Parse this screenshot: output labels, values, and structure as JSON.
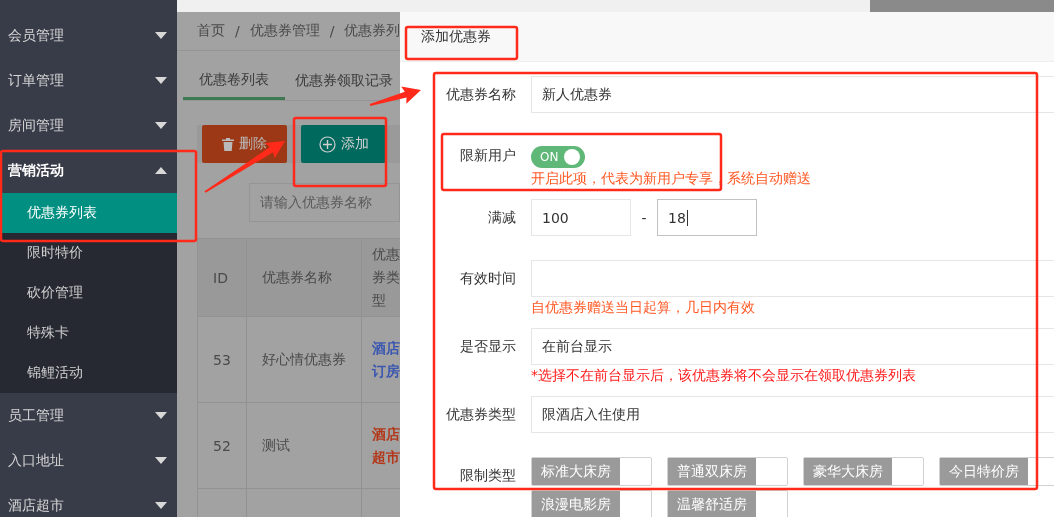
{
  "sidebar": {
    "items": [
      {
        "label": "会员管理",
        "expanded": false
      },
      {
        "label": "订单管理",
        "expanded": false
      },
      {
        "label": "房间管理",
        "expanded": false
      },
      {
        "label": "营销活动",
        "expanded": true,
        "children": [
          {
            "label": "优惠券列表",
            "selected": true
          },
          {
            "label": "限时特价",
            "selected": false
          },
          {
            "label": "砍价管理",
            "selected": false
          },
          {
            "label": "特殊卡",
            "selected": false
          },
          {
            "label": "锦鲤活动",
            "selected": false
          }
        ]
      },
      {
        "label": "员工管理",
        "expanded": false
      },
      {
        "label": "入口地址",
        "expanded": false
      },
      {
        "label": "酒店超市",
        "expanded": false
      }
    ]
  },
  "breadcrumb": {
    "items": [
      "首页",
      "优惠券管理",
      "优惠券列"
    ],
    "separator": "/"
  },
  "tabs": [
    {
      "label": "优惠卷列表",
      "selected": true
    },
    {
      "label": "优惠券领取记录",
      "selected": false
    }
  ],
  "toolbar": [
    {
      "label": "删除",
      "kind": "delete"
    },
    {
      "label": "添加",
      "kind": "add"
    }
  ],
  "search": {
    "placeholder": "请输入优惠券名称"
  },
  "table": {
    "columns": [
      "ID",
      "优惠券名称",
      "优惠券类型"
    ],
    "rows": [
      {
        "cells": [
          "53",
          "好心情优惠券",
          "酒店订房"
        ],
        "color": "#3b57b0"
      },
      {
        "cells": [
          "52",
          "测试",
          "酒店超市"
        ],
        "color": "#b3381a"
      }
    ]
  },
  "dialog": {
    "title": "添加优惠券",
    "fields": [
      {
        "kind": "text",
        "label": "优惠券名称",
        "value": "新人优惠券"
      },
      {
        "kind": "switch",
        "label": "限新用户",
        "on": true,
        "switch_text": "ON",
        "hint": {
          "text": "开启此项，代表为新用户专享，系统自动赠送",
          "color": "#ff5722"
        }
      },
      {
        "kind": "range",
        "label": "满减",
        "separator": "-",
        "values": [
          {
            "value": "100",
            "focused": false
          },
          {
            "value": "18",
            "focused": true
          }
        ]
      },
      {
        "kind": "text",
        "label": "有效时间",
        "hint": {
          "text": "自优惠券赠送当日起算，几日内有效",
          "color": "#ff5722"
        }
      },
      {
        "kind": "text",
        "label": "是否显示",
        "value": "在前台显示",
        "hint": {
          "text": "*选择不在前台显示后，该优惠券将不会显示在领取优惠券列表",
          "color": "#ff1a1a"
        }
      },
      {
        "kind": "text",
        "label": "优惠券类型",
        "value": "限酒店入住使用"
      },
      {
        "kind": "checkboxes",
        "label": "限制类型",
        "options": [
          {
            "label": "标准大床房",
            "checked": false
          },
          {
            "label": "普通双床房",
            "checked": false
          },
          {
            "label": "豪华大床房",
            "checked": false
          },
          {
            "label": "今日特价房",
            "checked": false
          },
          {
            "label": "浪漫电影房",
            "checked": false
          },
          {
            "label": "温馨舒适房",
            "checked": false
          }
        ]
      }
    ]
  }
}
